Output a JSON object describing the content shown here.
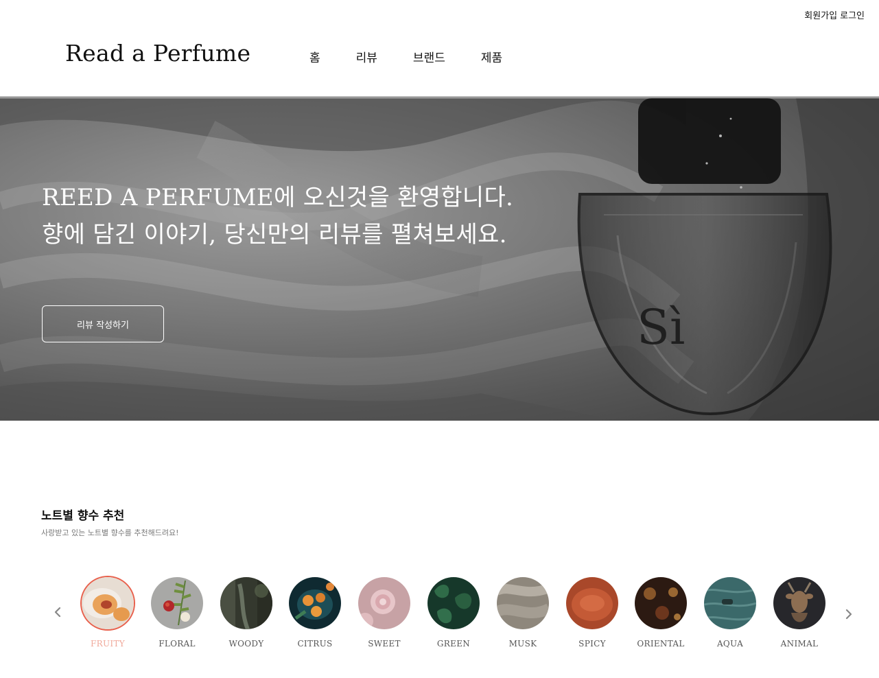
{
  "util_links": {
    "signup": "회원가입",
    "login": "로그인"
  },
  "header": {
    "logo": "Read a Perfume",
    "nav": [
      "홈",
      "리뷰",
      "브랜드",
      "제품"
    ]
  },
  "hero": {
    "line1": "REED A PERFUME에 오신것을 환영합니다.",
    "line2": "향에 담긴 이야기, 당신만의 리뷰를 펼쳐보세요.",
    "button": "리뷰 작성하기",
    "bottle_text": "Sì"
  },
  "notes_section": {
    "title": "노트별 향수 추천",
    "subtitle": "사랑받고 있는 노트별 향수를 추천해드려요!",
    "active_index": 0,
    "items": [
      {
        "label": "FRUITY",
        "color": "#c98a5a"
      },
      {
        "label": "FLORAL",
        "color": "#9a9a9a"
      },
      {
        "label": "WOODY",
        "color": "#3c4036"
      },
      {
        "label": "CITRUS",
        "color": "#13323a"
      },
      {
        "label": "SWEET",
        "color": "#c9a3a8"
      },
      {
        "label": "GREEN",
        "color": "#1f4a32"
      },
      {
        "label": "MUSK",
        "color": "#8f887e"
      },
      {
        "label": "SPICY",
        "color": "#b5532f"
      },
      {
        "label": "ORIENTAL",
        "color": "#3a2418"
      },
      {
        "label": "AQUA",
        "color": "#3e6b6c"
      },
      {
        "label": "ANIMAL",
        "color": "#2c2c30"
      }
    ]
  },
  "icons": [
    "chevron-left-icon",
    "chevron-right-icon"
  ]
}
